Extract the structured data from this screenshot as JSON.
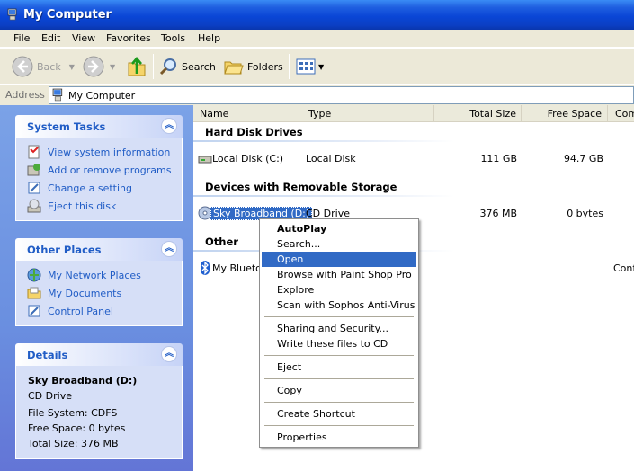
{
  "window": {
    "title": "My Computer"
  },
  "menu": [
    "File",
    "Edit",
    "View",
    "Favorites",
    "Tools",
    "Help"
  ],
  "toolbar": {
    "back": "Back",
    "search": "Search",
    "folders": "Folders"
  },
  "address": {
    "label": "Address",
    "value": "My Computer"
  },
  "system_tasks": {
    "title": "System Tasks",
    "items": [
      "View system information",
      "Add or remove programs",
      "Change a setting",
      "Eject this disk"
    ]
  },
  "other_places": {
    "title": "Other Places",
    "items": [
      "My Network Places",
      "My Documents",
      "Control Panel"
    ]
  },
  "details": {
    "title": "Details",
    "name": "Sky Broadband (D:)",
    "type": "CD Drive",
    "file_system": "File System: CDFS",
    "free_space": "Free Space: 0 bytes",
    "total_size": "Total Size: 376 MB"
  },
  "columns": [
    "Name",
    "Type",
    "Total Size",
    "Free Space",
    "Com"
  ],
  "groups": {
    "hdd": "Hard Disk Drives",
    "removable": "Devices with Removable Storage",
    "other": "Other"
  },
  "rows": {
    "local_disk": {
      "name": "Local Disk (C:)",
      "type": "Local Disk",
      "total": "111 GB",
      "free": "94.7 GB"
    },
    "cd_drive": {
      "name": "Sky Broadband (D:)",
      "type": "CD Drive",
      "total": "376 MB",
      "free": "0 bytes"
    },
    "bluetooth": {
      "name": "My Bluetoo",
      "comment": "Conf"
    }
  },
  "context_menu": {
    "autoplay": "AutoPlay",
    "search": "Search...",
    "open": "Open",
    "paintshop": "Browse with Paint Shop Pro",
    "explore": "Explore",
    "sophos": "Scan with Sophos Anti-Virus",
    "sharing": "Sharing and Security...",
    "write_cd": "Write these files to CD",
    "eject": "Eject",
    "copy": "Copy",
    "shortcut": "Create Shortcut",
    "properties": "Properties"
  },
  "colors": {
    "title_blue": "#0a46d6",
    "selection": "#316ac5",
    "task_link": "#215dc6",
    "task_pane": "#6a8fe0"
  }
}
